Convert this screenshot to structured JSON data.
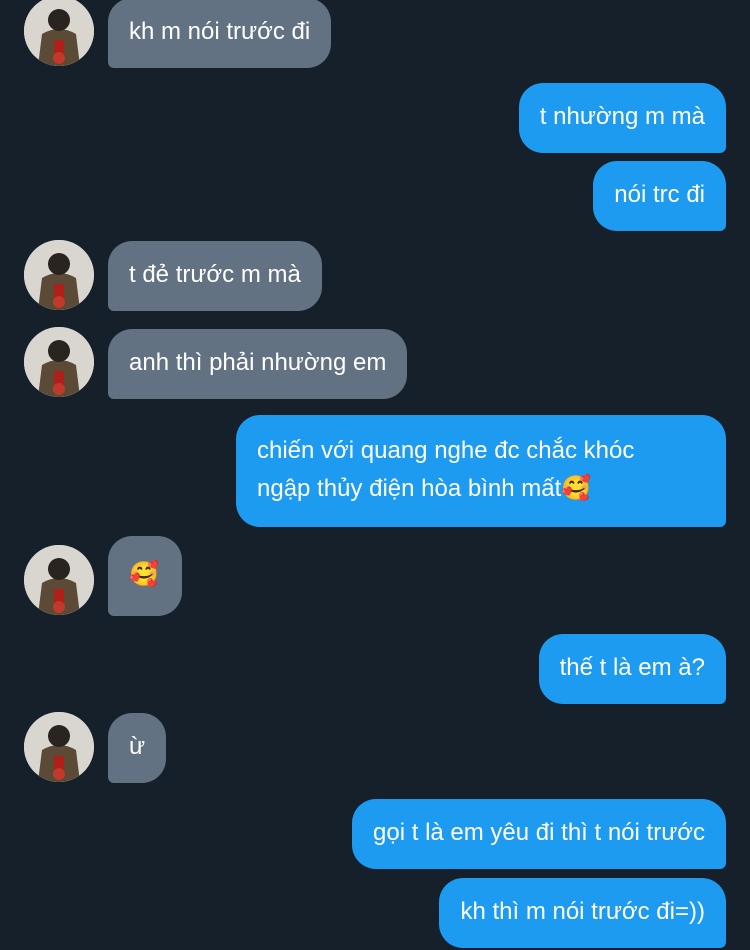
{
  "avatar_icon": "user-avatar-icon",
  "colors": {
    "background": "#15202b",
    "received_bubble": "#627282",
    "sent_bubble": "#1d9bf0",
    "text": "#ffffff"
  },
  "messages": [
    {
      "side": "received",
      "text": "kh m nói trước đi"
    },
    {
      "side": "sent",
      "text": "t nhường m mà"
    },
    {
      "side": "sent",
      "text": "nói trc đi"
    },
    {
      "side": "received",
      "text": "t đẻ trước m mà"
    },
    {
      "side": "received",
      "text": "anh thì phải nhường em"
    },
    {
      "side": "sent",
      "text_line1": "chiến với quang nghe đc chắc khóc",
      "text_line2": "ngập thủy điện hòa bình mất🥰"
    },
    {
      "side": "received",
      "text": "🥰"
    },
    {
      "side": "sent",
      "text": "thế t là em à?"
    },
    {
      "side": "received",
      "text": "ừ"
    },
    {
      "side": "sent",
      "text": "gọi t là em yêu đi thì t nói trước"
    },
    {
      "side": "sent",
      "text": "kh thì m nói trước đi=))"
    }
  ]
}
